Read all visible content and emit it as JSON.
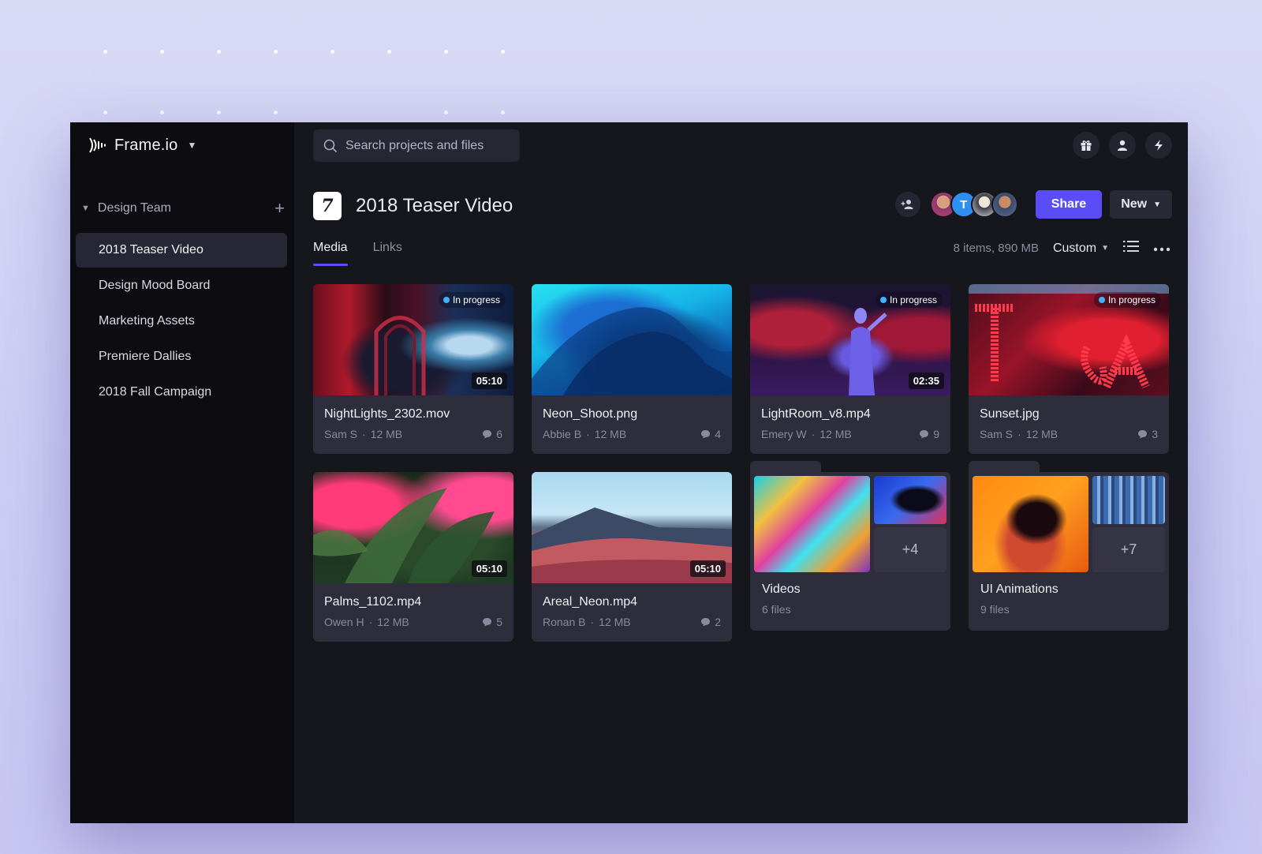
{
  "app": {
    "brand": "Frame.io",
    "team": "Design Team",
    "projects": [
      {
        "label": "2018 Teaser Video",
        "active": true
      },
      {
        "label": "Design Mood Board"
      },
      {
        "label": "Marketing Assets"
      },
      {
        "label": "Premiere Dallies"
      },
      {
        "label": "2018 Fall Campaign"
      }
    ]
  },
  "search": {
    "placeholder": "Search projects and files"
  },
  "project": {
    "icon_letter": "7",
    "title": "2018 Teaser Video",
    "avatar_letter": "T",
    "share_label": "Share",
    "new_label": "New"
  },
  "tabs": [
    {
      "label": "Media"
    },
    {
      "label": "Links"
    }
  ],
  "toolbar": {
    "count": "8 items, 890 MB",
    "sort": "Custom"
  },
  "items": [
    {
      "name": "NightLights_2302.mov",
      "author": "Sam S",
      "size": "12 MB",
      "comments": "6",
      "duration": "05:10",
      "status": "In progress"
    },
    {
      "name": "Neon_Shoot.png",
      "author": "Abbie B",
      "size": "12 MB",
      "comments": "4"
    },
    {
      "name": "LightRoom_v8.mp4",
      "author": "Emery W",
      "size": "12 MB",
      "comments": "9",
      "duration": "02:35",
      "status": "In progress"
    },
    {
      "name": "Sunset.jpg",
      "author": "Sam S",
      "size": "12 MB",
      "comments": "3",
      "status": "In progress"
    },
    {
      "name": "Palms_1102.mp4",
      "author": "Owen H",
      "size": "12 MB",
      "comments": "5",
      "duration": "05:10"
    },
    {
      "name": "Areal_Neon.mp4",
      "author": "Ronan B",
      "size": "12 MB",
      "comments": "2",
      "duration": "05:10"
    }
  ],
  "folders": [
    {
      "name": "Videos",
      "count": "6 files",
      "more": "+4"
    },
    {
      "name": "UI Animations",
      "count": "9 files",
      "more": "+7"
    }
  ],
  "colors": {
    "accent": "#5a4cf6",
    "status": "#3fb4ff",
    "background": "#16161d",
    "sidebar": "#0d0d11"
  }
}
